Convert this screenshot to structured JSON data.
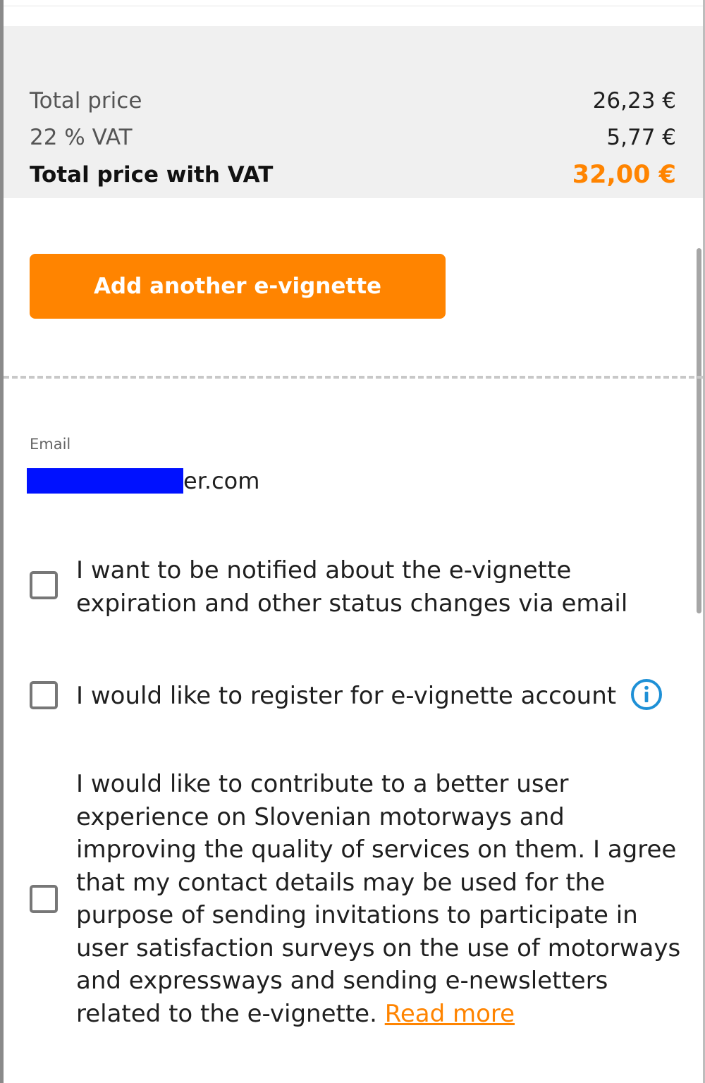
{
  "summary": {
    "rows": [
      {
        "label": "Total price",
        "amount": "26,23 €"
      },
      {
        "label": "22 % VAT",
        "amount": "5,77 €"
      },
      {
        "label": "Total price with VAT",
        "amount": "32,00 €"
      }
    ]
  },
  "actions": {
    "add_vignette_label": "Add another e-vignette"
  },
  "email": {
    "label": "Email",
    "visible_value": "er.com"
  },
  "options": {
    "notify_label": "I want to be notified about the e-vignette expiration and other status changes via email",
    "register_label": "I would like to register for e-vignette account",
    "survey_label": "I would like to contribute to a better user experience on Slovenian motorways and improving the quality of services on them. I agree that my contact details may be used for the purpose of sending invitations to participate in user satisfaction surveys on the use of motorways and expressways and sending e-newsletters related to the e-vignette.",
    "read_more_label": "Read more"
  },
  "icons": {
    "info": "info-icon",
    "checkbox": "checkbox-icon"
  },
  "colors": {
    "accent": "#ff8400",
    "panel_bg": "#f0f0f0",
    "info_blue": "#1e90d6",
    "redaction": "#0011ff"
  }
}
